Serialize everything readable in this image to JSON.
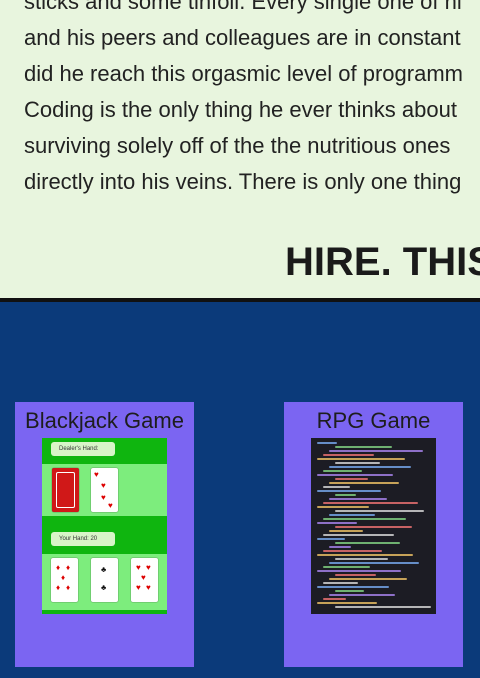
{
  "about": {
    "lines": [
      "sticks and some tinfoil. Every single one of hi",
      "and his peers and colleagues are in constant",
      "did he reach this orgasmic level of programm",
      "Coding is the only thing he ever thinks about",
      "surviving solely off of the the nutritious ones",
      "directly into his veins. There is only one thing"
    ],
    "headline": "HIRE. THIS"
  },
  "projects": [
    {
      "title": "Blackjack Game",
      "thumbnail": {
        "dealer_label": "Dealer's Hand:",
        "player_label": "Your Hand: 20"
      }
    },
    {
      "title": "RPG Game"
    }
  ],
  "colors": {
    "about_bg": "#e8f5de",
    "projects_bg": "#0b3a7a",
    "card_bg": "#7b65f2",
    "felt_green": "#0fb50f"
  }
}
